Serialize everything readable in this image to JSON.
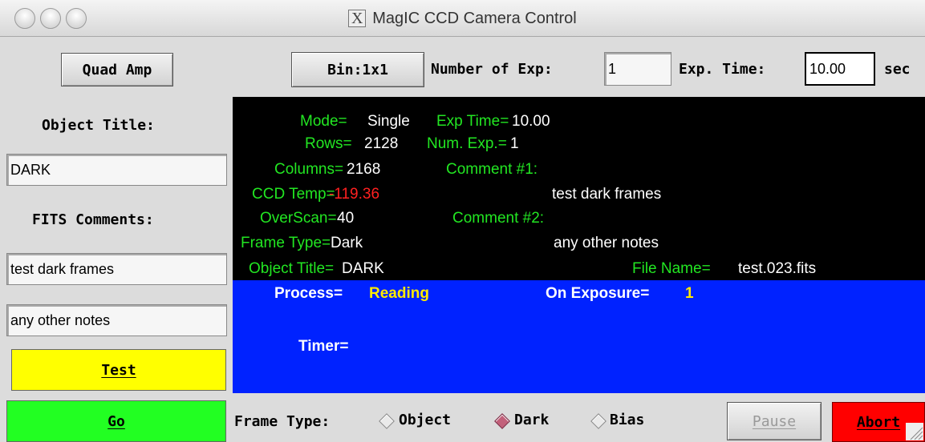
{
  "window": {
    "title": "MagIC CCD Camera Control"
  },
  "toolbar": {
    "quad_amp": "Quad Amp",
    "bin": "Bin:1x1",
    "num_exp_label": "Number of Exp:",
    "num_exp_value": "1",
    "exp_time_label": "Exp. Time:",
    "exp_time_value": "10.00",
    "exp_time_unit": "sec"
  },
  "sidebar": {
    "object_title_label": "Object Title:",
    "object_title_value": "DARK",
    "fits_comments_label": "FITS Comments:",
    "comment1_value": "test dark frames",
    "comment2_value": "any other notes",
    "test_button": "Test",
    "go_button": "Go"
  },
  "info": {
    "mode_label": "Mode=",
    "mode_value": "Single",
    "exp_time_label": "Exp Time=",
    "exp_time_value": "10.00",
    "rows_label": "Rows=",
    "rows_value": "2128",
    "num_exp_label": "Num. Exp.=",
    "num_exp_value": "1",
    "columns_label": "Columns=",
    "columns_value": "2168",
    "comment1_label": "Comment #1:",
    "ccd_temp_label": "CCD Temp=",
    "ccd_temp_value": "-119.36",
    "comment1_value": "test dark frames",
    "overscan_label": "OverScan=",
    "overscan_value": "40",
    "comment2_label": "Comment #2:",
    "frame_type_label": "Frame Type=",
    "frame_type_value": "Dark",
    "comment2_value": "any other notes",
    "object_title_label": "Object Title=",
    "object_title_value": "DARK",
    "file_name_label": "File Name=",
    "file_name_value": "test.023.fits"
  },
  "status": {
    "process_label": "Process=",
    "process_value": "Reading",
    "on_exposure_label": "On Exposure=",
    "on_exposure_value": "1",
    "timer_label": "Timer="
  },
  "bottom": {
    "frame_type_label": "Frame Type:",
    "options": [
      "Object",
      "Dark",
      "Bias"
    ],
    "selected": "Dark",
    "pause": "Pause",
    "abort": "Abort"
  },
  "colors": {
    "info_bg": "#000000",
    "label_green": "#22e622",
    "temp_red": "#ff2020",
    "status_blue": "#0022ff",
    "status_yellow": "#ffea00",
    "test_yellow": "#ffff00",
    "go_green": "#22ff22",
    "abort_red": "#ff0000"
  }
}
